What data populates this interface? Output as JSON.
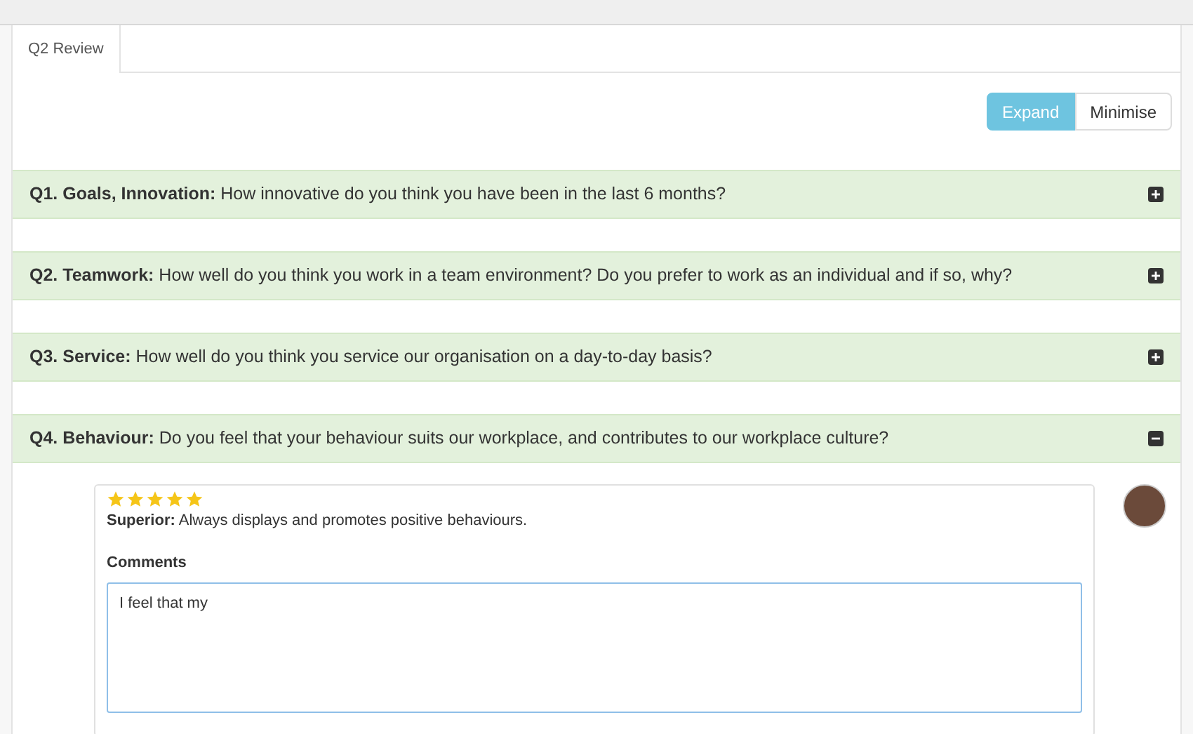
{
  "tabs": [
    {
      "label": "Q2 Review",
      "selected": true
    }
  ],
  "toolbar": {
    "buttons": [
      {
        "label": "Expand",
        "selected": true
      },
      {
        "label": "Minimise",
        "selected": false
      }
    ]
  },
  "questions": [
    {
      "title": "Q1. Goals, Innovation:",
      "text": "How innovative do you think you have been in the last 6 months?",
      "expanded": false
    },
    {
      "title": "Q2. Teamwork:",
      "text": "How well do you think you work in a team environment? Do you prefer to work as an individual and if so, why?",
      "expanded": false
    },
    {
      "title": "Q3. Service:",
      "text": "How well do you think you service our organisation on a day-to-day basis?",
      "expanded": false
    },
    {
      "title": "Q4. Behaviour:",
      "text": "Do you feel that your behaviour suits our workplace, and contributes to our workplace culture?",
      "expanded": true,
      "review": {
        "stars": 5,
        "rating_text": "**Superior:** Always displays and promotes positive behaviours.",
        "comments_label": "Comments",
        "comments_value": "I feel that my"
      }
    }
  ]
}
